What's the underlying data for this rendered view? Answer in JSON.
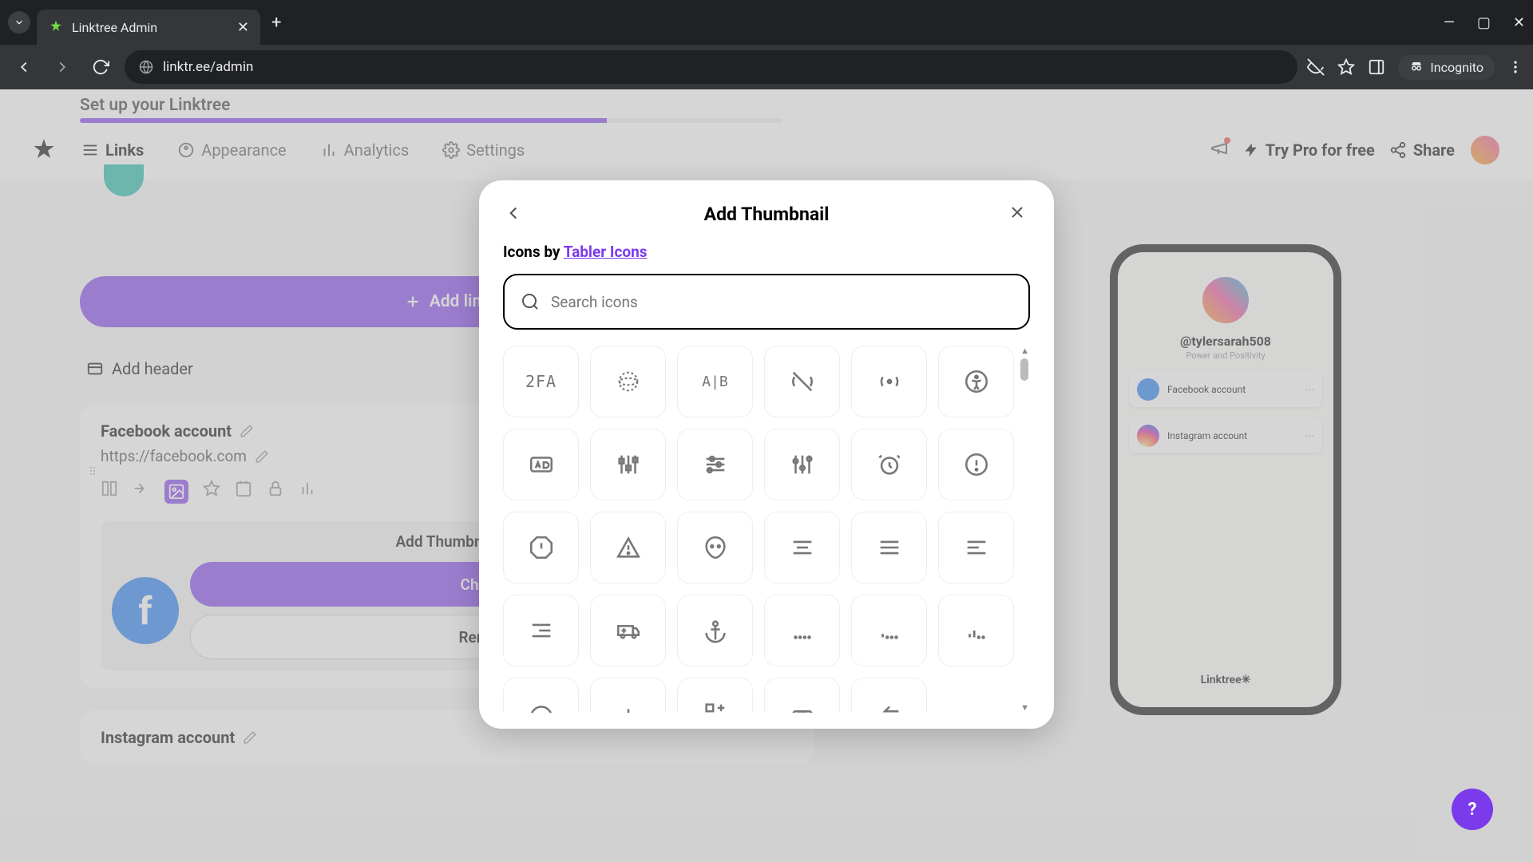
{
  "browser": {
    "tab_title": "Linktree Admin",
    "url": "linktr.ee/admin",
    "incognito_label": "Incognito"
  },
  "setup": {
    "text": "Set up your Linktree"
  },
  "nav": {
    "links": "Links",
    "appearance": "Appearance",
    "analytics": "Analytics",
    "settings": "Settings",
    "try_pro": "Try Pro for free",
    "share": "Share"
  },
  "main": {
    "add_link": "Add link",
    "add_header": "Add header",
    "link1": {
      "title": "Facebook account",
      "url": "https://facebook.com"
    },
    "thumb": {
      "title": "Add Thumbnail",
      "change": "Change",
      "remove": "Remove"
    },
    "link2": {
      "title": "Instagram account"
    }
  },
  "preview": {
    "handle": "@tylersarah508",
    "tagline": "Power and Positivity",
    "link_fb": "Facebook account",
    "link_ig": "Instagram account",
    "footer": "Linktree✳"
  },
  "modal": {
    "title": "Add Thumbnail",
    "icons_by_prefix": "Icons by ",
    "icons_by_link": "Tabler Icons",
    "search_placeholder": "Search icons",
    "icon_names": [
      "2fa",
      "3d-cube",
      "a-b",
      "access-point-off",
      "access-point",
      "accessible",
      "ad",
      "adjustments-alt",
      "adjustments-horizontal",
      "adjustments",
      "alarm",
      "alert-circle",
      "alert-octagon",
      "alert-triangle",
      "alien",
      "align-center",
      "align-justified",
      "align-left",
      "align-right",
      "ambulance",
      "anchor",
      "antenna-bars-1",
      "antenna-bars-2",
      "antenna-bars-3",
      "aperture",
      "app-window",
      "apps-plus",
      "archive",
      "arrow-back"
    ]
  },
  "fab": {
    "label": "?"
  }
}
